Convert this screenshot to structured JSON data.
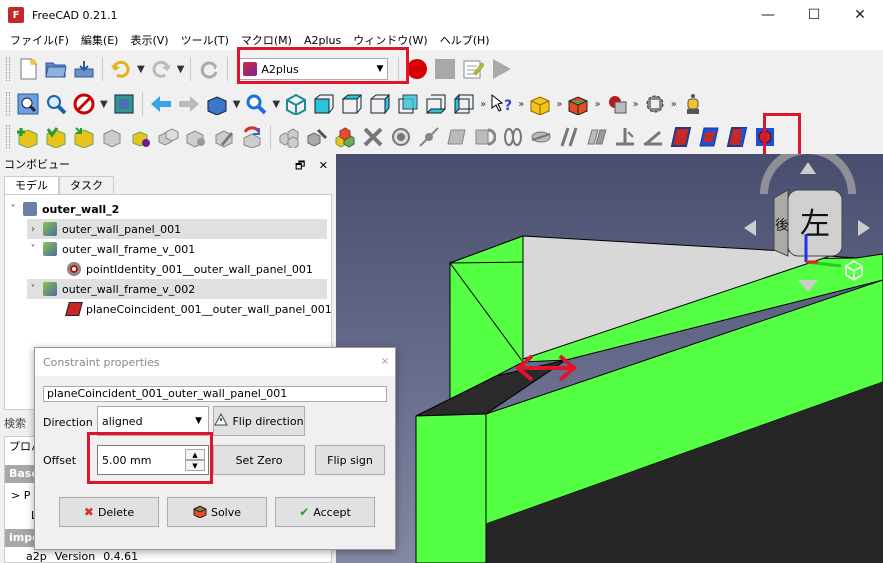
{
  "window": {
    "title": "FreeCAD 0.21.1",
    "app_icon": "F",
    "buttons": [
      "—",
      "☐",
      "✕"
    ]
  },
  "menu": [
    "ファイル(F)",
    "編集(E)",
    "表示(V)",
    "ツール(T)",
    "マクロ(M)",
    "A2plus",
    "ウィンドウ(W)",
    "ヘルプ(H)"
  ],
  "workbench_selector": {
    "value": "A2plus"
  },
  "combo_view": {
    "title": "コンボビュー",
    "controls": [
      "🗗",
      "✕"
    ],
    "tabs": [
      "モデル",
      "タスク"
    ],
    "tree": [
      {
        "label": "outer_wall_2",
        "expander": "˅"
      },
      {
        "label": "outer_wall_panel_001",
        "expander": "›"
      },
      {
        "label": "outer_wall_frame_v_001",
        "expander": "˅"
      },
      {
        "label": "pointIdentity_001__outer_wall_panel_001",
        "expander": ""
      },
      {
        "label": "outer_wall_frame_v_002",
        "expander": "˅"
      },
      {
        "label": "planeCoincident_001__outer_wall_panel_001",
        "expander": ""
      }
    ],
    "search_label": "検索",
    "property_header": "プロパ",
    "property_groups": [
      "Base",
      "impo"
    ],
    "property_rows": [
      ">  P",
      "L"
    ],
    "version_row": {
      "group": "a2p",
      "name": "Version",
      "value": "0.4.61"
    }
  },
  "dialog": {
    "title": "Constraint properties",
    "close": "×",
    "constraint_name": "planeCoincident_001_outer_wall_panel_001",
    "direction_label": "Direction",
    "direction_value": "aligned",
    "flip_direction_label": "Flip direction",
    "offset_label": "Offset",
    "offset_value": "5.00 mm",
    "set_zero_label": "Set Zero",
    "flip_sign_label": "Flip sign",
    "delete_label": "Delete",
    "solve_label": "Solve",
    "accept_label": "Accept"
  },
  "navcube": {
    "face_label": "左",
    "side_label": "後"
  },
  "colors": {
    "highlight": "#e0142d",
    "part_green": "#55ff44",
    "face_gray": "#d8d8d8"
  }
}
